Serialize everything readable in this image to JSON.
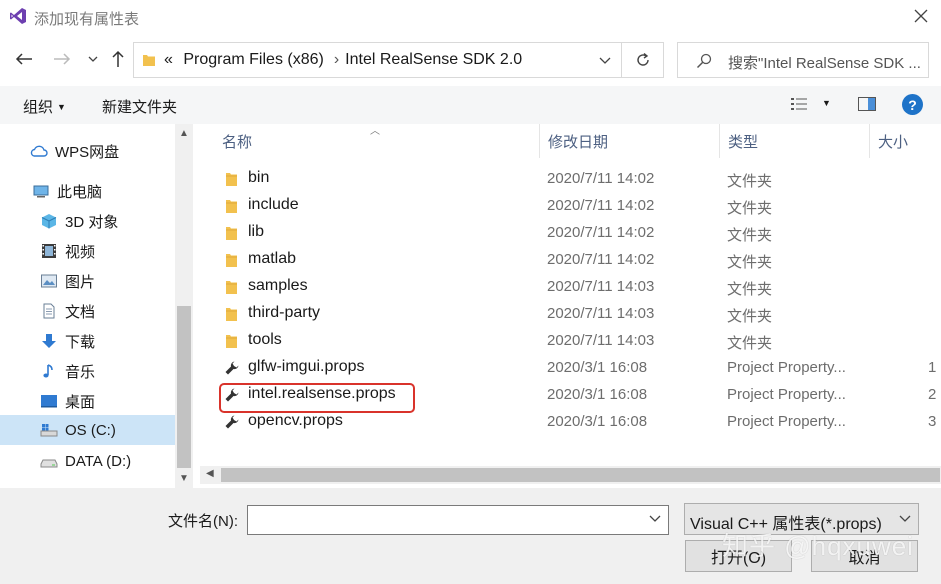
{
  "window": {
    "title": "添加现有属性表"
  },
  "address": {
    "overflow": "«",
    "crumbs": [
      "Program Files (x86)",
      "Intel RealSense SDK 2.0"
    ]
  },
  "search": {
    "placeholder": "搜索\"Intel RealSense SDK ..."
  },
  "toolbar": {
    "organize": "组织",
    "new_folder": "新建文件夹"
  },
  "sidebar": {
    "items": [
      {
        "label": "WPS网盘",
        "icon": "cloud-icon"
      },
      {
        "label": "此电脑",
        "icon": "computer-icon"
      },
      {
        "label": "3D 对象",
        "icon": "cube-icon"
      },
      {
        "label": "视频",
        "icon": "video-icon"
      },
      {
        "label": "图片",
        "icon": "picture-icon"
      },
      {
        "label": "文档",
        "icon": "document-icon"
      },
      {
        "label": "下载",
        "icon": "download-icon"
      },
      {
        "label": "音乐",
        "icon": "music-icon"
      },
      {
        "label": "桌面",
        "icon": "desktop-icon"
      },
      {
        "label": "OS (C:)",
        "icon": "drive-icon",
        "selected": true
      },
      {
        "label": "DATA (D:)",
        "icon": "drive-icon"
      }
    ]
  },
  "columns": {
    "name": "名称",
    "modified": "修改日期",
    "type": "类型",
    "size": "大小"
  },
  "files": [
    {
      "name": "bin",
      "date": "2020/7/11 14:02",
      "type": "文件夹",
      "size": "",
      "icon": "folder-icon"
    },
    {
      "name": "include",
      "date": "2020/7/11 14:02",
      "type": "文件夹",
      "size": "",
      "icon": "folder-icon"
    },
    {
      "name": "lib",
      "date": "2020/7/11 14:02",
      "type": "文件夹",
      "size": "",
      "icon": "folder-icon"
    },
    {
      "name": "matlab",
      "date": "2020/7/11 14:02",
      "type": "文件夹",
      "size": "",
      "icon": "folder-icon"
    },
    {
      "name": "samples",
      "date": "2020/7/11 14:03",
      "type": "文件夹",
      "size": "",
      "icon": "folder-icon"
    },
    {
      "name": "third-party",
      "date": "2020/7/11 14:03",
      "type": "文件夹",
      "size": "",
      "icon": "folder-icon"
    },
    {
      "name": "tools",
      "date": "2020/7/11 14:03",
      "type": "文件夹",
      "size": "",
      "icon": "folder-icon"
    },
    {
      "name": "glfw-imgui.props",
      "date": "2020/3/1 16:08",
      "type": "Project Property...",
      "size": "1",
      "icon": "wrench-icon"
    },
    {
      "name": "intel.realsense.props",
      "date": "2020/3/1 16:08",
      "type": "Project Property...",
      "size": "2",
      "icon": "wrench-icon"
    },
    {
      "name": "opencv.props",
      "date": "2020/3/1 16:08",
      "type": "Project Property...",
      "size": "3",
      "icon": "wrench-icon"
    }
  ],
  "bottom": {
    "filename_label": "文件名(N):",
    "filename_value": "",
    "filter": "Visual C++ 属性表(*.props)",
    "open": "打开(O)",
    "cancel": "取消"
  },
  "watermark": "知乎 @hqxuwei",
  "colors": {
    "folder": "#f2c14e",
    "highlight": "#d9332b",
    "selected": "#cce4f7",
    "accent": "#1e73c8"
  }
}
